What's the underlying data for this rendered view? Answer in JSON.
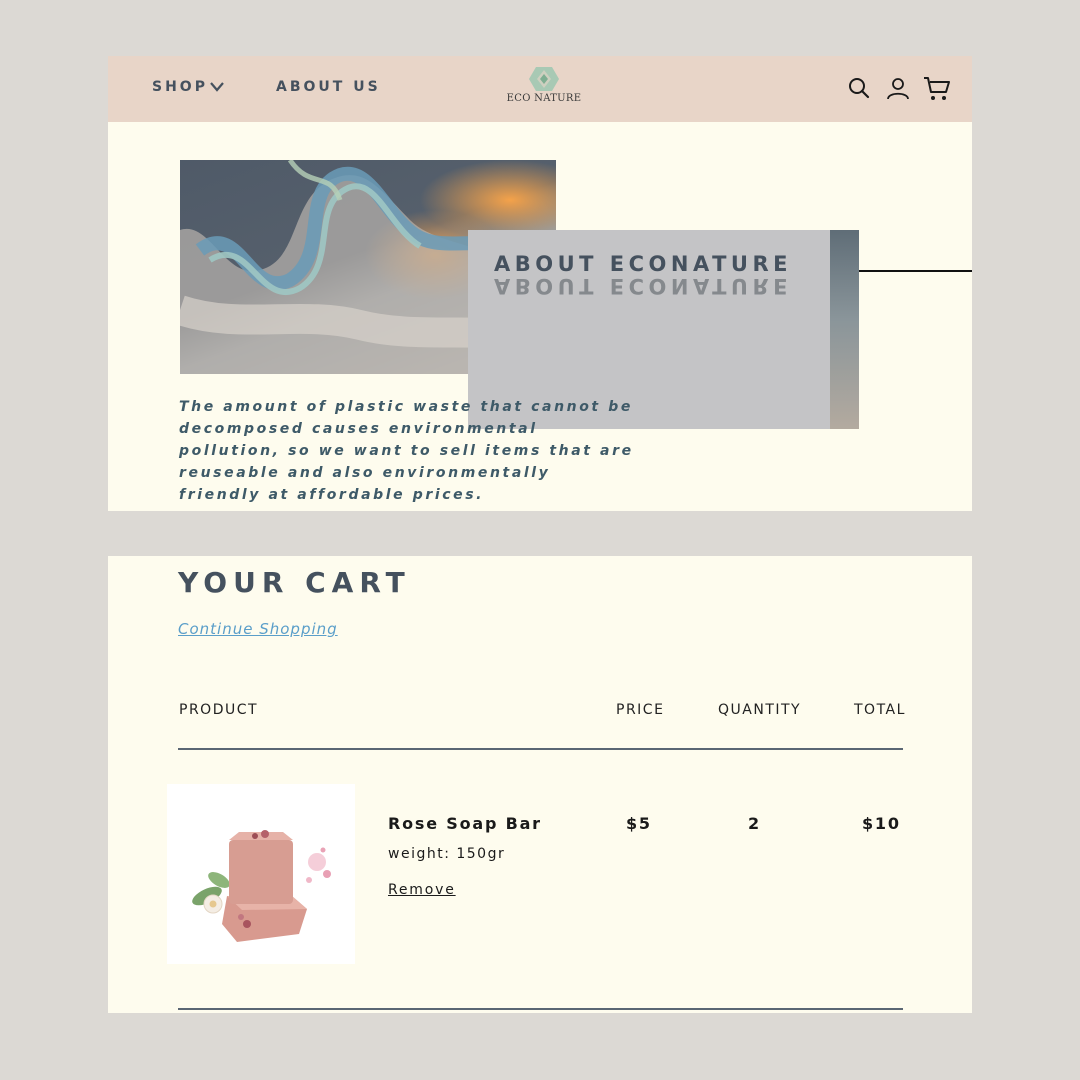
{
  "header": {
    "nav": {
      "shop": "SHOP",
      "about": "ABOUT US"
    },
    "logo_text": "ECO NATURE",
    "icons": [
      "search-icon",
      "user-icon",
      "cart-icon"
    ],
    "colors": {
      "background": "#e8d5c8",
      "text": "#45515e"
    }
  },
  "about": {
    "title": "ABOUT ECONATURE",
    "body": "The amount of plastic waste that cannot be decomposed causes environmental pollution, so we want to sell items that are reuseable and also environmentally friendly at affordable prices.",
    "colors": {
      "box": "#c4c4c6",
      "body_text": "#3e5a68"
    }
  },
  "cart": {
    "title": "YOUR CART",
    "continue_label": "Continue Shopping",
    "columns": {
      "product": "PRODUCT",
      "price": "PRICE",
      "quantity": "QUANTITY",
      "total": "TOTAL"
    },
    "items": [
      {
        "name": "Rose Soap Bar",
        "weight": "weight: 150gr",
        "remove_label": "Remove",
        "price": "$5",
        "quantity": "2",
        "total": "$10"
      }
    ],
    "colors": {
      "link": "#5a9ec9",
      "panel": "#fefcee",
      "page": "#dcd9d4"
    }
  }
}
